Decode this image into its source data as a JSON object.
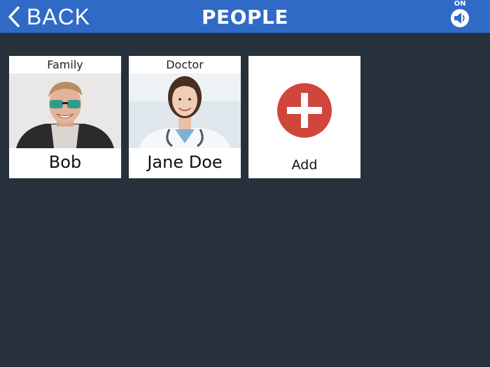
{
  "header": {
    "back_label": "BACK",
    "title": "PEOPLE",
    "sound_state": "ON"
  },
  "people": [
    {
      "category": "Family",
      "name": "Bob"
    },
    {
      "category": "Doctor",
      "name": "Jane Doe"
    }
  ],
  "add_tile": {
    "label": "Add"
  },
  "colors": {
    "header_bg": "#2f6ac6",
    "page_bg": "#27313c",
    "add_red": "#d1463c"
  }
}
